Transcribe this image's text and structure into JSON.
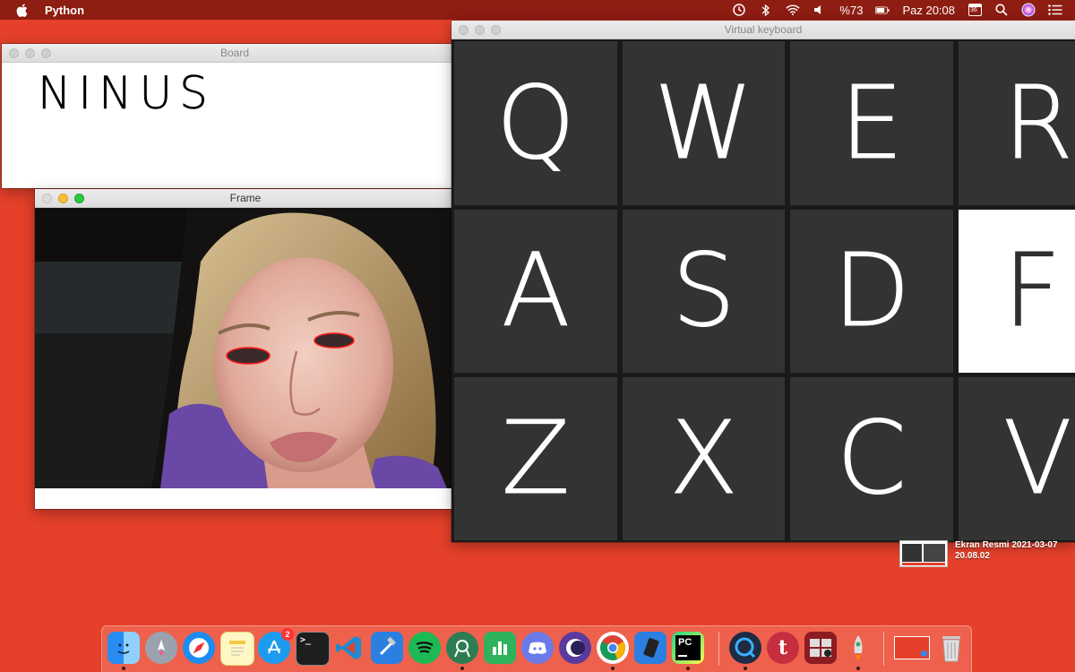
{
  "menubar": {
    "app_name": "Python",
    "battery": "%73",
    "clock": "Paz 20:08",
    "calendar_day": "36"
  },
  "board": {
    "title": "Board",
    "text": "NINUS"
  },
  "frame": {
    "title": "Frame"
  },
  "virtual_keyboard": {
    "title": "Virtual keyboard",
    "rows": [
      [
        "Q",
        "W",
        "E",
        "R"
      ],
      [
        "A",
        "S",
        "D",
        "F"
      ],
      [
        "Z",
        "X",
        "C",
        "V"
      ]
    ],
    "highlighted_key": "F"
  },
  "desktop_file": {
    "label": "Ekran Resmi 2021-03-07\n20.08.02"
  },
  "dock": {
    "app_store_badge": "2",
    "items": [
      "finder-icon",
      "launchpad-icon",
      "safari-icon",
      "notes-icon",
      "app-store-icon",
      "terminal-icon",
      "vscode-icon",
      "xcode-icon",
      "spotify-icon",
      "android-studio-icon",
      "numbers-icon",
      "discord-icon",
      "eclipse-icon",
      "chrome-icon",
      "simulator-icon",
      "pycharm-icon",
      "quicktime-icon",
      "tumblr-icon",
      "photo-booth-icon",
      "rocket-icon",
      "downloads-stack-icon",
      "trash-icon"
    ]
  },
  "colors": {
    "desktop": "#e5402a",
    "menubar": "#8e1d12",
    "key_bg": "#333333",
    "key_highlight": "#ffffff"
  }
}
